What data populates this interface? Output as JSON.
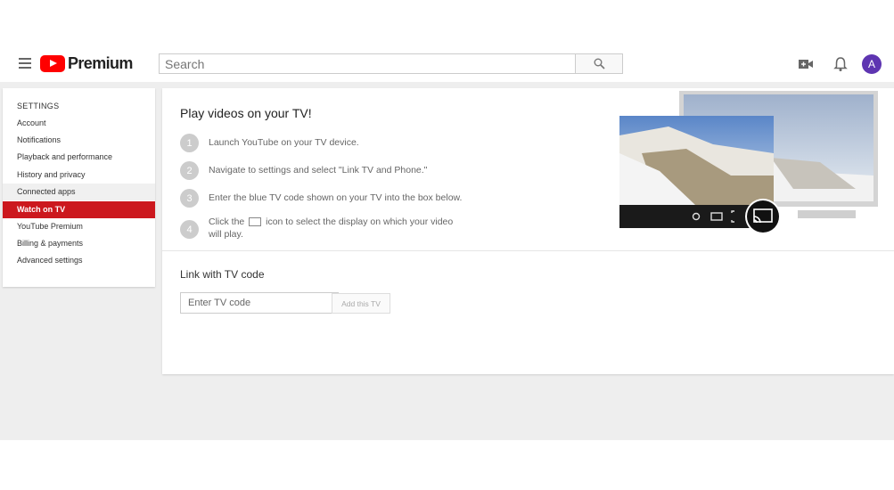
{
  "header": {
    "brand": "Premium",
    "search": {
      "placeholder": "Search",
      "value": ""
    },
    "avatar_letter": "A",
    "icons": [
      "menu-icon",
      "search-icon",
      "video-camera-icon",
      "bell-icon"
    ]
  },
  "sidebar": {
    "heading": "SETTINGS",
    "items": [
      {
        "label": "Account"
      },
      {
        "label": "Notifications"
      },
      {
        "label": "Playback and performance"
      },
      {
        "label": "History and privacy"
      },
      {
        "label": "Connected apps"
      },
      {
        "label": "Watch on TV"
      },
      {
        "label": "YouTube Premium"
      },
      {
        "label": "Billing & payments"
      },
      {
        "label": "Advanced settings"
      }
    ],
    "active": "Watch on TV"
  },
  "main": {
    "title": "Play videos on your TV!",
    "steps": [
      {
        "num": "1",
        "text": "Launch YouTube on your TV device."
      },
      {
        "num": "2",
        "text": "Navigate to settings and select \"Link TV and Phone.\""
      },
      {
        "num": "3",
        "text": "Enter the blue TV code shown on your TV into the box below."
      },
      {
        "num": "4",
        "text_before": "Click the",
        "text_after": "icon to select the display on which your video will play."
      }
    ],
    "link_section": {
      "title": "Link with TV code",
      "input_placeholder": "Enter TV code",
      "button_label": "Add this TV"
    }
  },
  "colors": {
    "brand_red": "#ff0000",
    "active_item": "#cc181e",
    "avatar": "#5e35b1",
    "page_gray": "#eeeeee"
  }
}
